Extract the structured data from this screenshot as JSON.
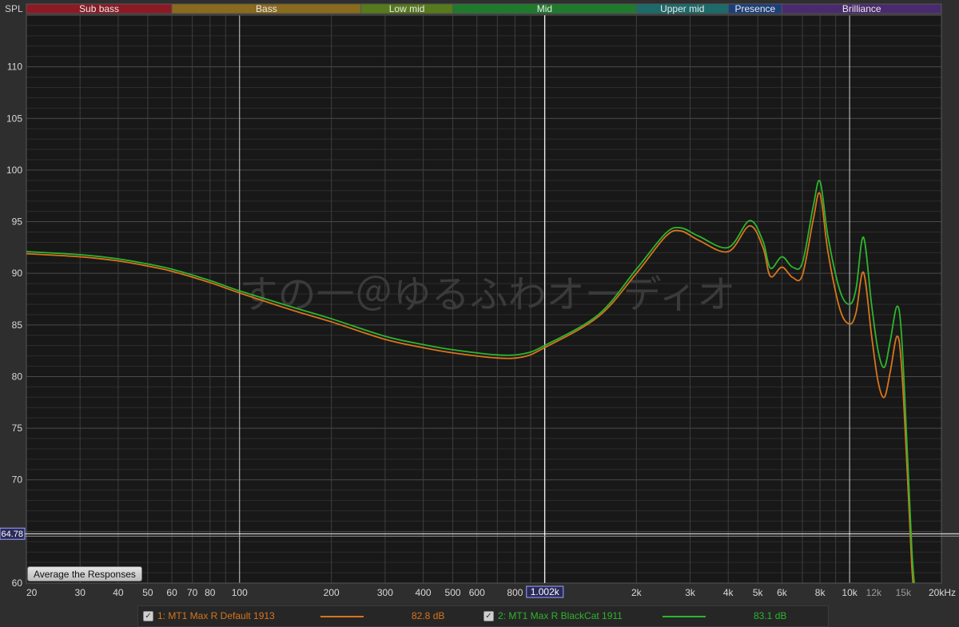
{
  "chart_data": {
    "type": "line",
    "ylabel": "SPL",
    "xscale": "log",
    "xlim": [
      20,
      20000
    ],
    "ylim": [
      60,
      115
    ],
    "grid": true,
    "y_ticks": [
      60,
      65,
      70,
      75,
      80,
      85,
      90,
      95,
      100,
      105,
      110
    ],
    "y_tick_labels": [
      "60",
      "",
      "70",
      "75",
      "80",
      "85",
      "90",
      "95",
      "100",
      "105",
      "110"
    ],
    "x_ticks": [
      20,
      30,
      40,
      50,
      60,
      70,
      80,
      100,
      200,
      300,
      400,
      500,
      600,
      800,
      2000,
      3000,
      4000,
      5000,
      6000,
      8000,
      10000,
      12000,
      15000,
      20000
    ],
    "x_tick_labels": [
      "20",
      "30",
      "40",
      "50",
      "60",
      "70",
      "80",
      "100",
      "200",
      "300",
      "400",
      "500",
      "600",
      "800",
      "2k",
      "3k",
      "4k",
      "5k",
      "6k",
      "8k",
      "10k",
      "12k",
      "15k",
      "20kHz"
    ],
    "cursor": {
      "x": 1002,
      "x_label": "1.002k",
      "y": 64.78,
      "y_label": "64.78"
    },
    "bands": [
      {
        "name": "Sub bass",
        "from": 20,
        "to": 60,
        "color": "#8b1a24"
      },
      {
        "name": "Bass",
        "from": 60,
        "to": 250,
        "color": "#8a6a1d"
      },
      {
        "name": "Low mid",
        "from": 250,
        "to": 500,
        "color": "#567a1c"
      },
      {
        "name": "Mid",
        "from": 500,
        "to": 2000,
        "color": "#1f7a2d"
      },
      {
        "name": "Upper mid",
        "from": 2000,
        "to": 4000,
        "color": "#1c6a6a"
      },
      {
        "name": "Presence",
        "from": 4000,
        "to": 6000,
        "color": "#1c3f7a"
      },
      {
        "name": "Brilliance",
        "from": 6000,
        "to": 20000,
        "color": "#4a2a6e"
      }
    ],
    "watermark": "すの一＠ゆるふわオーディオ",
    "series": [
      {
        "name": "1: MT1 Max R Default 1913",
        "level": "82.8 dB",
        "color": "#d8741c",
        "points": [
          [
            20,
            91.9
          ],
          [
            30,
            91.6
          ],
          [
            40,
            91.2
          ],
          [
            50,
            90.7
          ],
          [
            60,
            90.2
          ],
          [
            80,
            89.1
          ],
          [
            100,
            88.1
          ],
          [
            150,
            86.4
          ],
          [
            200,
            85.3
          ],
          [
            300,
            83.6
          ],
          [
            400,
            82.8
          ],
          [
            500,
            82.3
          ],
          [
            700,
            81.8
          ],
          [
            850,
            81.9
          ],
          [
            1000,
            82.8
          ],
          [
            1500,
            85.8
          ],
          [
            2000,
            90.0
          ],
          [
            2500,
            93.6
          ],
          [
            2800,
            94.1
          ],
          [
            3200,
            93.2
          ],
          [
            4000,
            92.1
          ],
          [
            4700,
            94.6
          ],
          [
            5200,
            92.5
          ],
          [
            5500,
            89.7
          ],
          [
            6000,
            90.6
          ],
          [
            6500,
            89.6
          ],
          [
            7000,
            89.8
          ],
          [
            7600,
            95.2
          ],
          [
            8000,
            97.7
          ],
          [
            8500,
            92.0
          ],
          [
            9300,
            86.5
          ],
          [
            10000,
            85.1
          ],
          [
            10500,
            86.2
          ],
          [
            11100,
            90.1
          ],
          [
            11800,
            84.0
          ],
          [
            12400,
            79.5
          ],
          [
            13000,
            78.0
          ],
          [
            13600,
            80.5
          ],
          [
            14300,
            83.9
          ],
          [
            14800,
            81.0
          ],
          [
            15500,
            70.0
          ],
          [
            16000,
            61.5
          ],
          [
            16400,
            58.0
          ]
        ]
      },
      {
        "name": "2: MT1 Max R BlackCat 1911",
        "level": "83.1 dB",
        "color": "#2db52d",
        "points": [
          [
            20,
            92.1
          ],
          [
            30,
            91.8
          ],
          [
            40,
            91.4
          ],
          [
            50,
            90.9
          ],
          [
            60,
            90.4
          ],
          [
            80,
            89.3
          ],
          [
            100,
            88.3
          ],
          [
            150,
            86.7
          ],
          [
            200,
            85.6
          ],
          [
            300,
            83.9
          ],
          [
            400,
            83.1
          ],
          [
            500,
            82.6
          ],
          [
            700,
            82.1
          ],
          [
            850,
            82.2
          ],
          [
            1000,
            83.0
          ],
          [
            1500,
            86.0
          ],
          [
            2000,
            90.4
          ],
          [
            2500,
            93.9
          ],
          [
            2800,
            94.4
          ],
          [
            3200,
            93.6
          ],
          [
            4000,
            92.5
          ],
          [
            4700,
            95.1
          ],
          [
            5200,
            93.1
          ],
          [
            5500,
            90.5
          ],
          [
            6000,
            91.6
          ],
          [
            6500,
            90.6
          ],
          [
            7000,
            91.0
          ],
          [
            7600,
            96.5
          ],
          [
            8000,
            98.9
          ],
          [
            8500,
            93.5
          ],
          [
            9300,
            88.3
          ],
          [
            10000,
            87.0
          ],
          [
            10500,
            88.5
          ],
          [
            11100,
            93.5
          ],
          [
            11800,
            87.0
          ],
          [
            12400,
            82.5
          ],
          [
            13000,
            80.9
          ],
          [
            13600,
            83.5
          ],
          [
            14300,
            86.8
          ],
          [
            14800,
            84.0
          ],
          [
            15500,
            72.0
          ],
          [
            16000,
            63.2
          ],
          [
            16400,
            59.0
          ]
        ]
      }
    ]
  },
  "ui": {
    "spl_label": "SPL",
    "average_button": "Average the Responses",
    "checkbox_mark": "✓"
  }
}
